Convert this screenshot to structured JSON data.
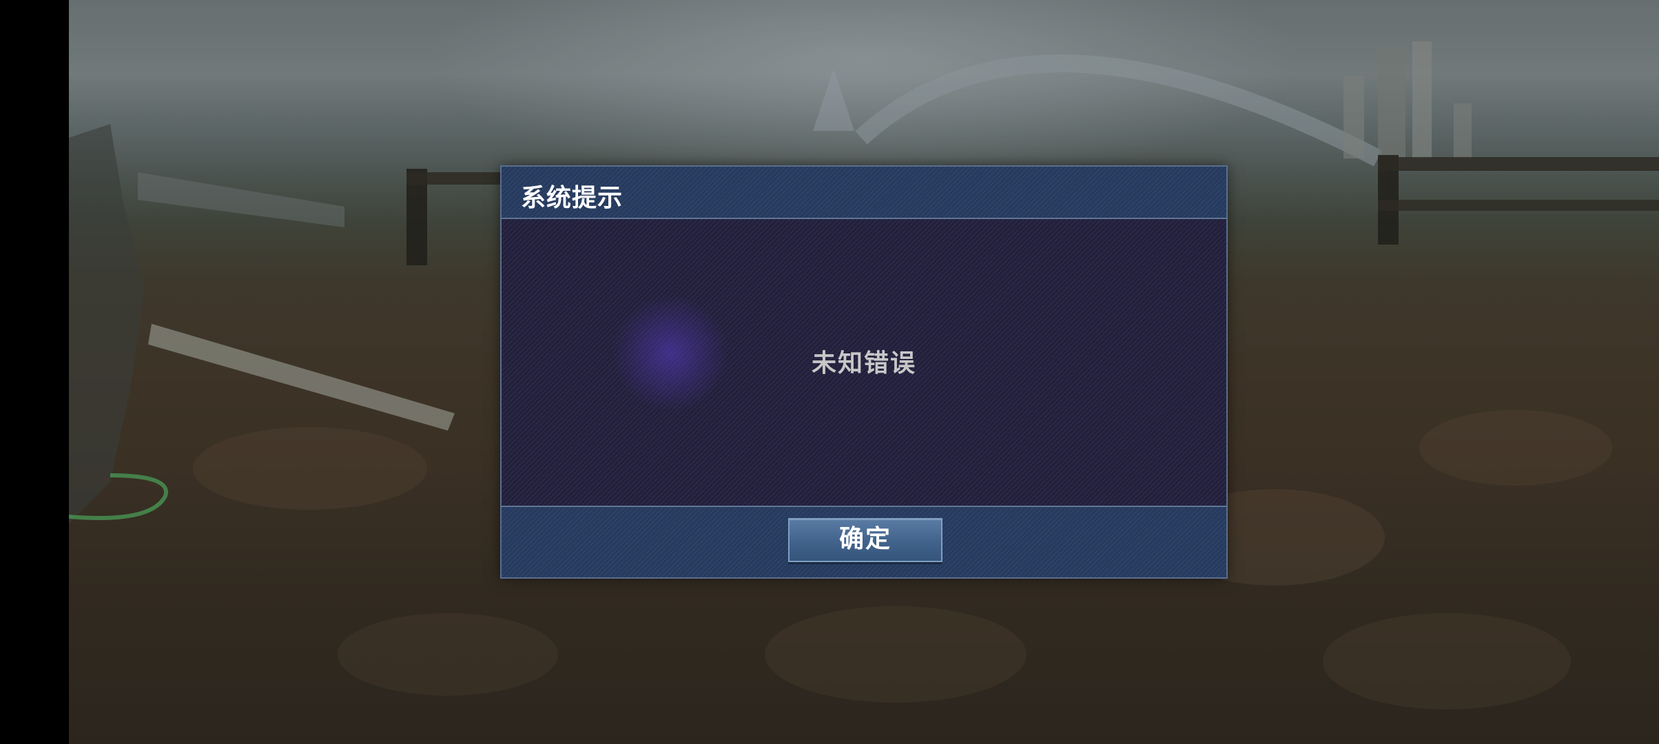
{
  "dialog": {
    "title": "系统提示",
    "message": "未知错误",
    "confirm_label": "确定"
  },
  "colors": {
    "header_footer_bg": "#253a5e",
    "body_bg": "#221f3c",
    "border": "#5a6e8e",
    "button_bg": "#41628a",
    "title_text": "#ffffff",
    "message_text": "#c7c7c7"
  }
}
